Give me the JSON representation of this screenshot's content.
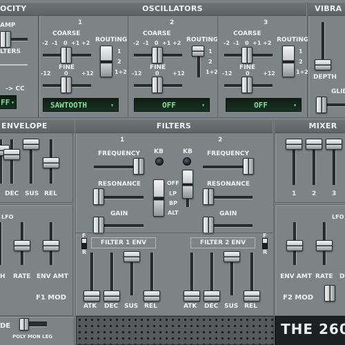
{
  "velocity": {
    "title": "OCITY",
    "amp": "AMP",
    "filters": "LTERS",
    "to_cc": "-> CC",
    "cc_value": "FF"
  },
  "oscillators": {
    "title": "OSCILLATORS",
    "osc": [
      {
        "num": "1",
        "coarse": "COARSE",
        "fine": "FINE",
        "routing": "ROUTING",
        "wave": "SAWTOOTH"
      },
      {
        "num": "2",
        "coarse": "COARSE",
        "fine": "FINE",
        "routing": "ROUTING",
        "wave": "OFF"
      },
      {
        "num": "3",
        "coarse": "COARSE",
        "fine": "FINE",
        "routing": "ROUTING",
        "wave": "OFF"
      }
    ],
    "coarse_scale": [
      "-2",
      "-1",
      "0",
      "+1",
      "+2"
    ],
    "fine_scale": [
      "-12",
      "0",
      "+12"
    ],
    "routing_scale": [
      "1",
      "2",
      "1+2"
    ]
  },
  "vibrato": {
    "title": "VIBRA",
    "depth": "DEPTH",
    "glide": "GLID"
  },
  "envelope": {
    "title": "ENVELOPE",
    "dec": "DEC",
    "sus": "SUS",
    "rel": "REL"
  },
  "filters": {
    "title": "FILTERS",
    "f1": "1",
    "f2": "2",
    "kb": "KB",
    "frequency": "FREQUENCY",
    "resonance": "RESONANCE",
    "gain": "GAIN",
    "modes": [
      "OFF",
      "LP",
      "BP",
      "ALT"
    ],
    "filter1_env": "FILTER 1 ENV",
    "filter2_env": "FILTER 2 ENV",
    "adsr": [
      "ATK",
      "DEC",
      "SUS",
      "REL"
    ],
    "f": "F",
    "r": "R"
  },
  "mixer": {
    "title": "MIXER",
    "channels": [
      "1",
      "2",
      "3"
    ]
  },
  "f1mod": {
    "lfo": "LFO",
    "rate": "RATE",
    "env_amt": "ENV AMT",
    "title": "F1 MOD",
    "h": "H"
  },
  "f2mod": {
    "lfo": "LFO",
    "env_amt": "ENV AMT",
    "rate": "RATE",
    "title": "F2 MOD",
    "d": "D"
  },
  "footer": {
    "mode": "DE",
    "poly_mon_leg": "POLY MON LEG",
    "logo": "THE 260"
  },
  "colors": {
    "panel": "#7e8486",
    "header": "#62686a",
    "lcd_text": "#7fe09a",
    "lcd_bg": "#132818"
  }
}
